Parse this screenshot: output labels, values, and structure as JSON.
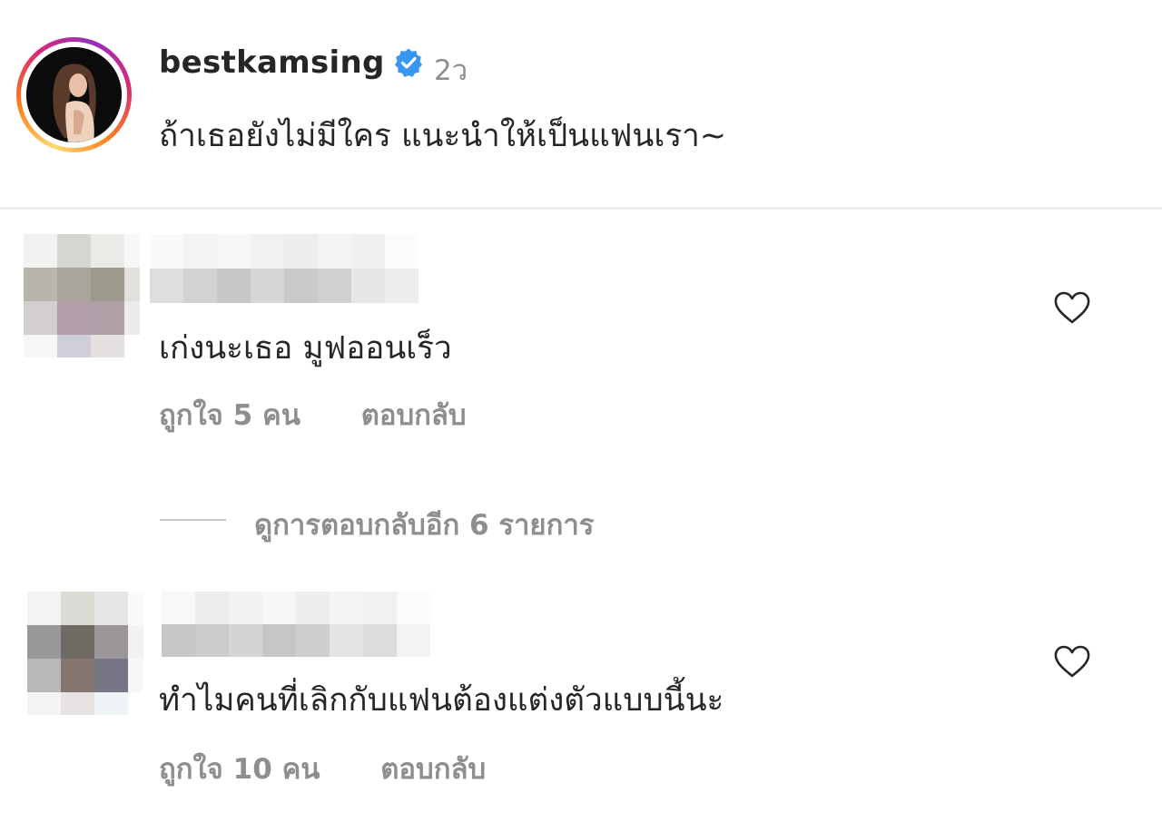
{
  "caption": {
    "username": "bestkamsing",
    "time": "2ว",
    "text": "ถ้าเธอยังไม่มีใคร แนะนำให้เป็นแฟนเรา~",
    "verified": true,
    "avatar_icon": "profile-photo",
    "verified_icon": "verified-badge-icon"
  },
  "comments": [
    {
      "text": "เก่งนะเธอ มูฟออนเร็ว",
      "likes": "ถูกใจ 5 คน",
      "reply": "ตอบกลับ",
      "avatar": "blurred-avatar",
      "username": "blurred-username",
      "like_icon": "heart-outline-icon"
    },
    {
      "text": "ทำไมคนที่เลิกกับแฟนต้องแต่งตัวแบบนี้นะ",
      "likes": "ถูกใจ 10 คน",
      "reply": "ตอบกลับ",
      "avatar": "blurred-avatar",
      "username": "blurred-username",
      "like_icon": "heart-outline-icon"
    }
  ],
  "view_replies": {
    "label": "ดูการตอบกลับอีก 6 รายการ"
  },
  "colors": {
    "text_primary": "#262626",
    "text_secondary": "#8e8e8e",
    "verified_blue": "#3897f0",
    "divider": "#ececec"
  }
}
